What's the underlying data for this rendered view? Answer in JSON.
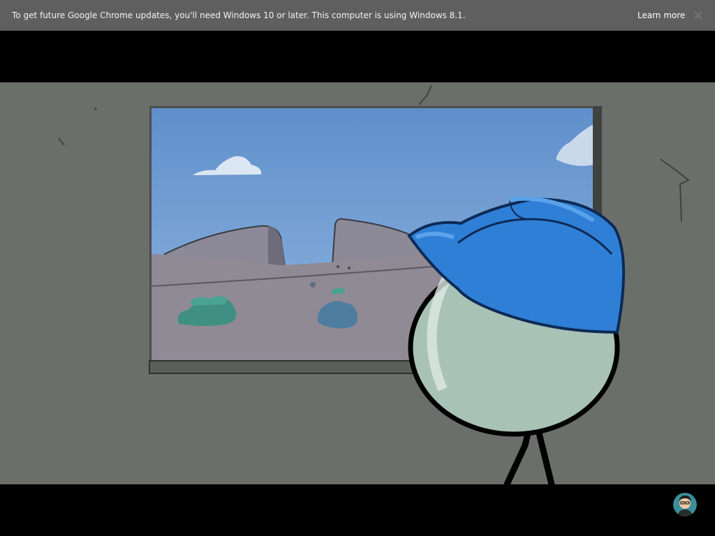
{
  "browser": {
    "infobar": {
      "message": "To get future Google Chrome updates, you'll need Windows 10 or later. This computer is using Windows 8.1.",
      "link_label": "Learn more",
      "close_icon": "close-icon"
    }
  },
  "game": {
    "scene": "wall-window-desert",
    "character": {
      "head_color": "#a8c2b5",
      "cap_color": "#2f7fd6"
    },
    "avatar_icon": "user-avatar-icon"
  },
  "colors": {
    "infobar_bg": "#5f5f5f",
    "wall": "#6b6f6a",
    "sky": "#6f9dd2",
    "ground": "#8f8a94",
    "cap": "#2f7fd6",
    "head": "#a8c2b5"
  }
}
